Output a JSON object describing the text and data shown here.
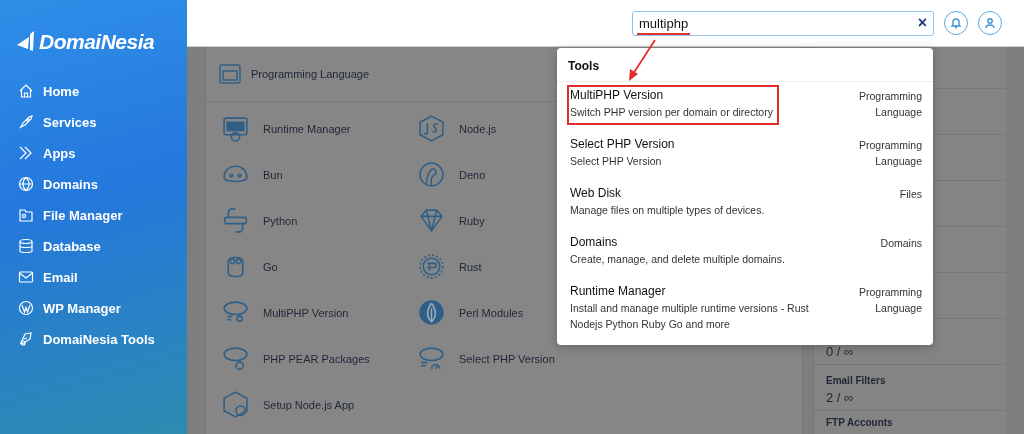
{
  "sidebar": {
    "logo": "DomaiNesia",
    "items": [
      {
        "label": "Home"
      },
      {
        "label": "Services"
      },
      {
        "label": "Apps"
      },
      {
        "label": "Domains"
      },
      {
        "label": "File Manager"
      },
      {
        "label": "Database"
      },
      {
        "label": "Email"
      },
      {
        "label": "WP Manager"
      },
      {
        "label": "DomaiNesia Tools"
      }
    ]
  },
  "topbar": {
    "search": {
      "value": "multiphp",
      "clear": "×"
    }
  },
  "panel": {
    "title": "Programming Language",
    "tools": [
      {
        "label": "Runtime Manager"
      },
      {
        "label": "Node.js"
      },
      {
        "label": "Bun"
      },
      {
        "label": "Deno"
      },
      {
        "label": "Python"
      },
      {
        "label": "Ruby"
      },
      {
        "label": "Go"
      },
      {
        "label": "Rust"
      },
      {
        "label": "MultiPHP Version"
      },
      {
        "label": "Perl Modules"
      },
      {
        "label": "PHP PEAR Packages"
      },
      {
        "label": "Select PHP Version"
      },
      {
        "label": "Setup Node.js App"
      }
    ]
  },
  "stats": [
    {
      "value": "0 / ∞"
    },
    {
      "label": "Email Filters",
      "value": "2 / ∞"
    },
    {
      "label": "FTP Accounts"
    }
  ],
  "search_results": {
    "heading": "Tools",
    "results": [
      {
        "title": "MultiPHP Version",
        "description": "Switch PHP version per domain or directory",
        "category": "Programming Language",
        "highlighted": true
      },
      {
        "title": "Select PHP Version",
        "description": "Select PHP Version",
        "category": "Programming Language",
        "highlighted": false
      },
      {
        "title": "Web Disk",
        "description": "Manage files on multiple types of devices.",
        "category": "Files",
        "highlighted": false
      },
      {
        "title": "Domains",
        "description": "Create, manage, and delete multiple domains.",
        "category": "Domains",
        "highlighted": false
      },
      {
        "title": "Runtime Manager",
        "description": "Install and manage multiple runtime versions - Rust Nodejs Python Ruby Go and more",
        "category": "Programming Language",
        "highlighted": false
      }
    ]
  },
  "annotation": {
    "underline": true,
    "arrow": true
  }
}
